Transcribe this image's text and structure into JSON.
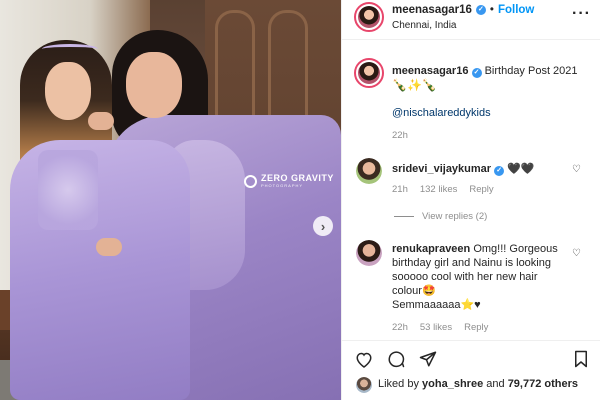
{
  "post": {
    "watermark": {
      "title": "ZERO GRAVITY",
      "subtitle": "PHOTOGRAPHY"
    },
    "next_icon": "chevron-right-icon"
  },
  "header": {
    "username": "meenasagar16",
    "follow_label": "Follow",
    "separator": "•",
    "location": "Chennai, India",
    "more_label": "···"
  },
  "caption": {
    "username": "meenasagar16",
    "text": "Birthday Post 2021",
    "emojis": "🍾✨🍾",
    "mention": "@nischalareddykids",
    "time": "22h"
  },
  "comments": [
    {
      "username": "sridevi_vijaykumar",
      "text": "🖤🖤",
      "time": "21h",
      "likes": "132 likes",
      "reply_label": "Reply",
      "view_replies": "View replies (2)"
    },
    {
      "username": "renukapraveen",
      "text": "Omg!!! Gorgeous birthday girl and Nainu is looking sooooo cool with her new hair colour🤩",
      "text2": "Semmaaaaaa⭐♥",
      "time": "22h",
      "likes": "53 likes",
      "reply_label": "Reply"
    }
  ],
  "likes_bar": {
    "prefix": "Liked by",
    "user": "yoha_shree",
    "middle": "and",
    "others": "79,772 others"
  },
  "colors": {
    "accent": "#0095f6",
    "verified": "#3897f0",
    "dress": "#a995d6"
  }
}
